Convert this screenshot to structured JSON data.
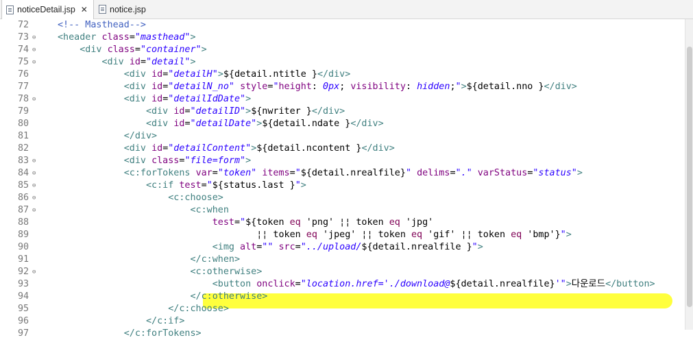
{
  "tabs": [
    {
      "label": "noticeDetail.jsp",
      "active": true,
      "close": "✕"
    },
    {
      "label": "notice.jsp",
      "active": false
    }
  ],
  "icons": {
    "file": "jsp-file-icon",
    "fold_open": "minus-fold-icon"
  },
  "lines": [
    {
      "n": "72",
      "fold": false,
      "html": "<span class=\"cmt\">&lt;!-- Masthead--&gt;</span>"
    },
    {
      "n": "73",
      "fold": true,
      "html": "<span class=\"tag\">&lt;header</span> <span class=\"attr\">class</span>=<span class=\"val\">\"masthead\"</span><span class=\"tag\">&gt;</span>"
    },
    {
      "n": "74",
      "fold": true,
      "html": "    <span class=\"tag\">&lt;div</span> <span class=\"attr\">class</span>=<span class=\"val\">\"container\"</span><span class=\"tag\">&gt;</span>"
    },
    {
      "n": "75",
      "fold": true,
      "html": "        <span class=\"tag\">&lt;div</span> <span class=\"attr\">id</span>=<span class=\"val\">\"detail\"</span><span class=\"tag\">&gt;</span>"
    },
    {
      "n": "76",
      "fold": false,
      "html": "            <span class=\"tag\">&lt;div</span> <span class=\"attr\">id</span>=<span class=\"val\">\"detailH\"</span><span class=\"tag\">&gt;</span>${detail.ntitle }<span class=\"tag\">&lt;/div&gt;</span>"
    },
    {
      "n": "77",
      "fold": false,
      "html": "            <span class=\"tag\">&lt;div</span> <span class=\"attr\">id</span>=<span class=\"val\">\"detailN_no\"</span> <span class=\"attr\">style</span>=<span class=\"str\">\"</span><span class=\"prop\">height</span>: <span class=\"pval\">0px</span>; <span class=\"prop\">visibility</span>: <span class=\"pval\">hidden</span>;<span class=\"str\">\"</span><span class=\"tag\">&gt;</span>${detail.nno }<span class=\"tag\">&lt;/div&gt;</span>"
    },
    {
      "n": "78",
      "fold": true,
      "html": "            <span class=\"tag\">&lt;div</span> <span class=\"attr\">id</span>=<span class=\"val\">\"detailIdDate\"</span><span class=\"tag\">&gt;</span>"
    },
    {
      "n": "79",
      "fold": false,
      "html": "                <span class=\"tag\">&lt;div</span> <span class=\"attr\">id</span>=<span class=\"val\">\"detailID\"</span><span class=\"tag\">&gt;</span>${nwriter }<span class=\"tag\">&lt;/div&gt;</span>"
    },
    {
      "n": "80",
      "fold": false,
      "html": "                <span class=\"tag\">&lt;div</span> <span class=\"attr\">id</span>=<span class=\"val\">\"detailDate\"</span><span class=\"tag\">&gt;</span>${detail.ndate }<span class=\"tag\">&lt;/div&gt;</span>"
    },
    {
      "n": "81",
      "fold": false,
      "html": "            <span class=\"tag\">&lt;/div&gt;</span>"
    },
    {
      "n": "82",
      "fold": false,
      "html": "            <span class=\"tag\">&lt;div</span> <span class=\"attr\">id</span>=<span class=\"val\">\"detailContent\"</span><span class=\"tag\">&gt;</span>${detail.ncontent }<span class=\"tag\">&lt;/div&gt;</span>"
    },
    {
      "n": "83",
      "fold": true,
      "html": "            <span class=\"tag\">&lt;div</span> <span class=\"attr\">class</span>=<span class=\"val\">\"file=form\"</span><span class=\"tag\">&gt;</span>"
    },
    {
      "n": "84",
      "fold": true,
      "html": "            <span class=\"tag\">&lt;c:forTokens</span> <span class=\"attr\">var</span>=<span class=\"val\">\"token\"</span> <span class=\"attr\">items</span>=<span class=\"val\">\"</span>${detail.nrealfile}<span class=\"val\">\"</span> <span class=\"attr\">delims</span>=<span class=\"val\">\".\"</span> <span class=\"attr\">varStatus</span>=<span class=\"val\">\"status\"</span><span class=\"tag\">&gt;</span>"
    },
    {
      "n": "85",
      "fold": true,
      "html": "                <span class=\"tag\">&lt;c:if</span> <span class=\"attr\">test</span>=<span class=\"val\">\"</span>${status.last }<span class=\"val\">\"</span><span class=\"tag\">&gt;</span>"
    },
    {
      "n": "86",
      "fold": true,
      "html": "                    <span class=\"tag\">&lt;c:choose&gt;</span>"
    },
    {
      "n": "87",
      "fold": true,
      "html": "                        <span class=\"tag\">&lt;c:when</span>"
    },
    {
      "n": "88",
      "fold": false,
      "html": "                            <span class=\"attr\">test</span>=<span class=\"val\">\"</span>${token <span class=\"kw\">eq</span> 'png' ¦¦ token <span class=\"kw\">eq</span> 'jpg'"
    },
    {
      "n": "89",
      "fold": false,
      "html": "                                    ¦¦ token <span class=\"kw\">eq</span> 'jpeg' ¦¦ token <span class=\"kw\">eq</span> 'gif' ¦¦ token <span class=\"kw\">eq</span> 'bmp'}<span class=\"val\">\"</span><span class=\"tag\">&gt;</span>"
    },
    {
      "n": "90",
      "fold": false,
      "html": "                            <span class=\"tag\">&lt;img</span> <span class=\"attr\">alt</span>=<span class=\"val\">\"\"</span> <span class=\"attr\">src</span>=<span class=\"val\">\"../upload/</span>${detail.nrealfile }<span class=\"val\">\"</span><span class=\"tag\">&gt;</span>"
    },
    {
      "n": "91",
      "fold": false,
      "html": "                        <span class=\"tag\">&lt;/c:when&gt;</span>"
    },
    {
      "n": "92",
      "fold": true,
      "html": "                        <span class=\"tag\">&lt;c:otherwise&gt;</span>"
    },
    {
      "n": "93",
      "fold": false,
      "html": "                            <span class=\"tag\">&lt;button</span> <span class=\"attr\">onclick</span>=<span class=\"val\">\"location.href='./download@</span>${detail.nrealfile}<span class=\"val\">'\"</span><span class=\"tag\">&gt;</span>다운로드<span class=\"tag\">&lt;/button&gt;</span>"
    },
    {
      "n": "94",
      "fold": false,
      "html": "                        <span class=\"tag\">&lt;/c:otherwise&gt;</span>"
    },
    {
      "n": "95",
      "fold": false,
      "html": "                    <span class=\"tag\">&lt;/c:choose&gt;</span>"
    },
    {
      "n": "96",
      "fold": false,
      "html": "                <span class=\"tag\">&lt;/c:if&gt;</span>"
    },
    {
      "n": "97",
      "fold": false,
      "html": "            <span class=\"tag\">&lt;/c:forTokens&gt;</span>"
    }
  ]
}
